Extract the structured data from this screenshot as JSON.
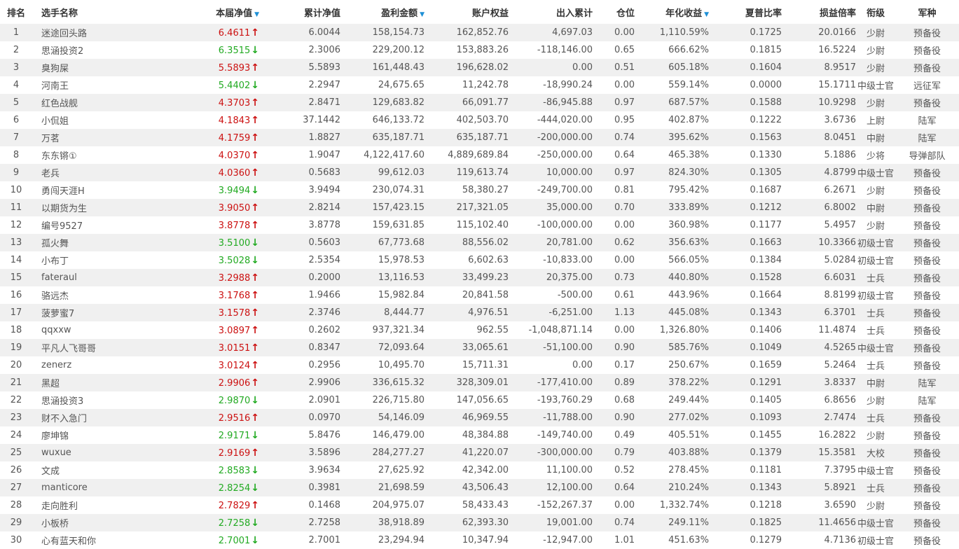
{
  "colors": {
    "up": "#cc1111",
    "down": "#22aa22",
    "sort": "#1e90d6",
    "stripe": "#f0f0f0"
  },
  "headers": {
    "rank": "排名",
    "name": "选手名称",
    "nav": "本届净值",
    "cum_nav": "累计净值",
    "profit": "盈利金额",
    "equity": "账户权益",
    "flow": "出入累计",
    "position": "仓位",
    "annual": "年化收益",
    "sharpe": "夏普比率",
    "pl_ratio": "损益倍率",
    "grade": "衔级",
    "branch": "军种"
  },
  "sort_icon": "sort-down-icon",
  "rows": [
    {
      "rank": "1",
      "name": "迷途回头路",
      "nav": "6.4611",
      "dir": "up",
      "cum_nav": "6.0044",
      "profit": "158,154.73",
      "equity": "162,852.76",
      "flow": "4,697.03",
      "position": "0.00",
      "annual": "1,110.59%",
      "sharpe": "0.1725",
      "pl_ratio": "20.0166",
      "grade": "少尉",
      "branch": "预备役"
    },
    {
      "rank": "2",
      "name": "思涵投资2",
      "nav": "6.3515",
      "dir": "down",
      "cum_nav": "2.3006",
      "profit": "229,200.12",
      "equity": "153,883.26",
      "flow": "-118,146.00",
      "position": "0.65",
      "annual": "666.62%",
      "sharpe": "0.1815",
      "pl_ratio": "16.5224",
      "grade": "少尉",
      "branch": "预备役"
    },
    {
      "rank": "3",
      "name": "臭狗屎",
      "nav": "5.5893",
      "dir": "up",
      "cum_nav": "5.5893",
      "profit": "161,448.43",
      "equity": "196,628.02",
      "flow": "0.00",
      "position": "0.51",
      "annual": "605.18%",
      "sharpe": "0.1604",
      "pl_ratio": "8.9517",
      "grade": "少尉",
      "branch": "预备役"
    },
    {
      "rank": "4",
      "name": "河南王",
      "nav": "5.4402",
      "dir": "down",
      "cum_nav": "2.2947",
      "profit": "24,675.65",
      "equity": "11,242.78",
      "flow": "-18,990.24",
      "position": "0.00",
      "annual": "559.14%",
      "sharpe": "0.0000",
      "pl_ratio": "15.1711",
      "grade": "中级士官",
      "branch": "远征军"
    },
    {
      "rank": "5",
      "name": "红色战舰",
      "nav": "4.3703",
      "dir": "up",
      "cum_nav": "2.8471",
      "profit": "129,683.82",
      "equity": "66,091.77",
      "flow": "-86,945.88",
      "position": "0.97",
      "annual": "687.57%",
      "sharpe": "0.1588",
      "pl_ratio": "10.9298",
      "grade": "少尉",
      "branch": "预备役"
    },
    {
      "rank": "6",
      "name": "小侃姐",
      "nav": "4.1843",
      "dir": "up",
      "cum_nav": "37.1442",
      "profit": "646,133.72",
      "equity": "402,503.70",
      "flow": "-444,020.00",
      "position": "0.95",
      "annual": "402.87%",
      "sharpe": "0.1222",
      "pl_ratio": "3.6736",
      "grade": "上尉",
      "branch": "陆军"
    },
    {
      "rank": "7",
      "name": "万茗",
      "nav": "4.1759",
      "dir": "up",
      "cum_nav": "1.8827",
      "profit": "635,187.71",
      "equity": "635,187.71",
      "flow": "-200,000.00",
      "position": "0.74",
      "annual": "395.62%",
      "sharpe": "0.1563",
      "pl_ratio": "8.0451",
      "grade": "中尉",
      "branch": "陆军"
    },
    {
      "rank": "8",
      "name": "东东锵①",
      "nav": "4.0370",
      "dir": "up",
      "cum_nav": "1.9047",
      "profit": "4,122,417.60",
      "equity": "4,889,689.84",
      "flow": "-250,000.00",
      "position": "0.64",
      "annual": "465.38%",
      "sharpe": "0.1330",
      "pl_ratio": "5.1886",
      "grade": "少将",
      "branch": "导弹部队"
    },
    {
      "rank": "9",
      "name": "老兵",
      "nav": "4.0360",
      "dir": "up",
      "cum_nav": "0.5683",
      "profit": "99,612.03",
      "equity": "119,613.74",
      "flow": "10,000.00",
      "position": "0.97",
      "annual": "824.30%",
      "sharpe": "0.1305",
      "pl_ratio": "4.8799",
      "grade": "中级士官",
      "branch": "预备役"
    },
    {
      "rank": "10",
      "name": "勇闯天涯H",
      "nav": "3.9494",
      "dir": "down",
      "cum_nav": "3.9494",
      "profit": "230,074.31",
      "equity": "58,380.27",
      "flow": "-249,700.00",
      "position": "0.81",
      "annual": "795.42%",
      "sharpe": "0.1687",
      "pl_ratio": "6.2671",
      "grade": "少尉",
      "branch": "预备役"
    },
    {
      "rank": "11",
      "name": "以期货为生",
      "nav": "3.9050",
      "dir": "up",
      "cum_nav": "2.8214",
      "profit": "157,423.15",
      "equity": "217,321.05",
      "flow": "35,000.00",
      "position": "0.70",
      "annual": "333.89%",
      "sharpe": "0.1212",
      "pl_ratio": "6.8002",
      "grade": "中尉",
      "branch": "预备役"
    },
    {
      "rank": "12",
      "name": "编号9527",
      "nav": "3.8778",
      "dir": "up",
      "cum_nav": "3.8778",
      "profit": "159,631.85",
      "equity": "115,102.40",
      "flow": "-100,000.00",
      "position": "0.00",
      "annual": "360.98%",
      "sharpe": "0.1177",
      "pl_ratio": "5.4957",
      "grade": "少尉",
      "branch": "预备役"
    },
    {
      "rank": "13",
      "name": "孤火舞",
      "nav": "3.5100",
      "dir": "down",
      "cum_nav": "0.5603",
      "profit": "67,773.68",
      "equity": "88,556.02",
      "flow": "20,781.00",
      "position": "0.62",
      "annual": "356.63%",
      "sharpe": "0.1663",
      "pl_ratio": "10.3366",
      "grade": "初级士官",
      "branch": "预备役"
    },
    {
      "rank": "14",
      "name": "小布丁",
      "nav": "3.5028",
      "dir": "down",
      "cum_nav": "2.5354",
      "profit": "15,978.53",
      "equity": "6,602.63",
      "flow": "-10,833.00",
      "position": "0.00",
      "annual": "566.05%",
      "sharpe": "0.1384",
      "pl_ratio": "5.0284",
      "grade": "初级士官",
      "branch": "预备役"
    },
    {
      "rank": "15",
      "name": "fateraul",
      "nav": "3.2988",
      "dir": "up",
      "cum_nav": "0.2000",
      "profit": "13,116.53",
      "equity": "33,499.23",
      "flow": "20,375.00",
      "position": "0.73",
      "annual": "440.80%",
      "sharpe": "0.1528",
      "pl_ratio": "6.6031",
      "grade": "士兵",
      "branch": "预备役"
    },
    {
      "rank": "16",
      "name": "骆远杰",
      "nav": "3.1768",
      "dir": "up",
      "cum_nav": "1.9466",
      "profit": "15,982.84",
      "equity": "20,841.58",
      "flow": "-500.00",
      "position": "0.61",
      "annual": "443.96%",
      "sharpe": "0.1664",
      "pl_ratio": "8.8199",
      "grade": "初级士官",
      "branch": "预备役"
    },
    {
      "rank": "17",
      "name": "菠萝蜜7",
      "nav": "3.1578",
      "dir": "up",
      "cum_nav": "2.3746",
      "profit": "8,444.77",
      "equity": "4,976.51",
      "flow": "-6,251.00",
      "position": "1.13",
      "annual": "445.08%",
      "sharpe": "0.1343",
      "pl_ratio": "6.3701",
      "grade": "士兵",
      "branch": "预备役"
    },
    {
      "rank": "18",
      "name": "qqxxw",
      "nav": "3.0897",
      "dir": "up",
      "cum_nav": "0.2602",
      "profit": "937,321.34",
      "equity": "962.55",
      "flow": "-1,048,871.14",
      "position": "0.00",
      "annual": "1,326.80%",
      "sharpe": "0.1406",
      "pl_ratio": "11.4874",
      "grade": "士兵",
      "branch": "预备役"
    },
    {
      "rank": "19",
      "name": "平凡人飞哥哥",
      "nav": "3.0151",
      "dir": "up",
      "cum_nav": "0.8347",
      "profit": "72,093.64",
      "equity": "33,065.61",
      "flow": "-51,100.00",
      "position": "0.90",
      "annual": "585.76%",
      "sharpe": "0.1049",
      "pl_ratio": "4.5265",
      "grade": "中级士官",
      "branch": "预备役"
    },
    {
      "rank": "20",
      "name": "zenerz",
      "nav": "3.0124",
      "dir": "up",
      "cum_nav": "0.2956",
      "profit": "10,495.70",
      "equity": "15,711.31",
      "flow": "0.00",
      "position": "0.17",
      "annual": "250.67%",
      "sharpe": "0.1659",
      "pl_ratio": "5.2464",
      "grade": "士兵",
      "branch": "预备役"
    },
    {
      "rank": "21",
      "name": "黑超",
      "nav": "2.9906",
      "dir": "up",
      "cum_nav": "2.9906",
      "profit": "336,615.32",
      "equity": "328,309.01",
      "flow": "-177,410.00",
      "position": "0.89",
      "annual": "378.22%",
      "sharpe": "0.1291",
      "pl_ratio": "3.8337",
      "grade": "中尉",
      "branch": "陆军"
    },
    {
      "rank": "22",
      "name": "思涵投资3",
      "nav": "2.9870",
      "dir": "down",
      "cum_nav": "2.0901",
      "profit": "226,715.80",
      "equity": "147,056.65",
      "flow": "-193,760.29",
      "position": "0.68",
      "annual": "249.44%",
      "sharpe": "0.1405",
      "pl_ratio": "6.8656",
      "grade": "少尉",
      "branch": "陆军"
    },
    {
      "rank": "23",
      "name": "财不入急门",
      "nav": "2.9516",
      "dir": "up",
      "cum_nav": "0.0970",
      "profit": "54,146.09",
      "equity": "46,969.55",
      "flow": "-11,788.00",
      "position": "0.90",
      "annual": "277.02%",
      "sharpe": "0.1093",
      "pl_ratio": "2.7474",
      "grade": "士兵",
      "branch": "预备役"
    },
    {
      "rank": "24",
      "name": "廖坤锦",
      "nav": "2.9171",
      "dir": "down",
      "cum_nav": "5.8476",
      "profit": "146,479.00",
      "equity": "48,384.88",
      "flow": "-149,740.00",
      "position": "0.49",
      "annual": "405.51%",
      "sharpe": "0.1455",
      "pl_ratio": "16.2822",
      "grade": "少尉",
      "branch": "预备役"
    },
    {
      "rank": "25",
      "name": "wuxue",
      "nav": "2.9169",
      "dir": "up",
      "cum_nav": "3.5896",
      "profit": "284,277.27",
      "equity": "41,220.07",
      "flow": "-300,000.00",
      "position": "0.79",
      "annual": "403.88%",
      "sharpe": "0.1379",
      "pl_ratio": "15.3581",
      "grade": "大校",
      "branch": "预备役"
    },
    {
      "rank": "26",
      "name": "文成",
      "nav": "2.8583",
      "dir": "down",
      "cum_nav": "3.9634",
      "profit": "27,625.92",
      "equity": "42,342.00",
      "flow": "11,100.00",
      "position": "0.52",
      "annual": "278.45%",
      "sharpe": "0.1181",
      "pl_ratio": "7.3795",
      "grade": "中级士官",
      "branch": "预备役"
    },
    {
      "rank": "27",
      "name": "manticore",
      "nav": "2.8254",
      "dir": "down",
      "cum_nav": "0.3981",
      "profit": "21,698.59",
      "equity": "43,506.43",
      "flow": "12,100.00",
      "position": "0.64",
      "annual": "210.24%",
      "sharpe": "0.1343",
      "pl_ratio": "5.8921",
      "grade": "士兵",
      "branch": "预备役"
    },
    {
      "rank": "28",
      "name": "走向胜利",
      "nav": "2.7829",
      "dir": "up",
      "cum_nav": "0.1468",
      "profit": "204,975.07",
      "equity": "58,433.43",
      "flow": "-152,267.37",
      "position": "0.00",
      "annual": "1,332.74%",
      "sharpe": "0.1218",
      "pl_ratio": "3.6590",
      "grade": "少尉",
      "branch": "预备役"
    },
    {
      "rank": "29",
      "name": "小板桥",
      "nav": "2.7258",
      "dir": "down",
      "cum_nav": "2.7258",
      "profit": "38,918.89",
      "equity": "62,393.30",
      "flow": "19,001.00",
      "position": "0.74",
      "annual": "249.11%",
      "sharpe": "0.1825",
      "pl_ratio": "11.4656",
      "grade": "中级士官",
      "branch": "预备役"
    },
    {
      "rank": "30",
      "name": "心有蓝天和你",
      "nav": "2.7001",
      "dir": "down",
      "cum_nav": "2.7001",
      "profit": "23,294.94",
      "equity": "10,347.94",
      "flow": "-12,947.00",
      "position": "1.01",
      "annual": "451.63%",
      "sharpe": "0.1279",
      "pl_ratio": "4.7136",
      "grade": "初级士官",
      "branch": "预备役"
    }
  ]
}
